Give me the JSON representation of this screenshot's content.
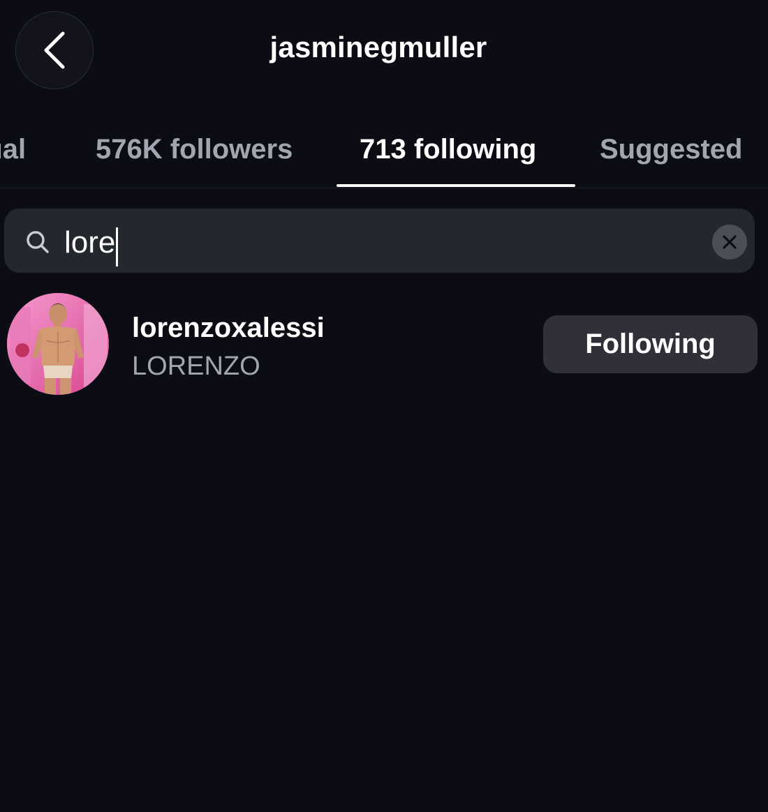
{
  "header": {
    "title": "jasminegmuller",
    "back_icon": "chevron-left-icon"
  },
  "tabs": [
    {
      "label": "Mutual",
      "visible_text": "tual",
      "active": false
    },
    {
      "label": "576K followers",
      "active": false
    },
    {
      "label": "713 following",
      "active": true
    },
    {
      "label": "Suggested",
      "active": false
    }
  ],
  "search": {
    "value": "lore",
    "icon": "search-icon",
    "clear_icon": "clear-icon"
  },
  "results": [
    {
      "username": "lorenzoxalessi",
      "full_name": "LORENZO",
      "button_label": "Following",
      "avatar_icon": "profile-photo"
    }
  ],
  "colors": {
    "background": "#0c0d14",
    "search_bg": "#25272f",
    "button_bg": "#2f3038",
    "secondary_text": "#a3a6b1",
    "avatar_accent": "#e064a8"
  }
}
